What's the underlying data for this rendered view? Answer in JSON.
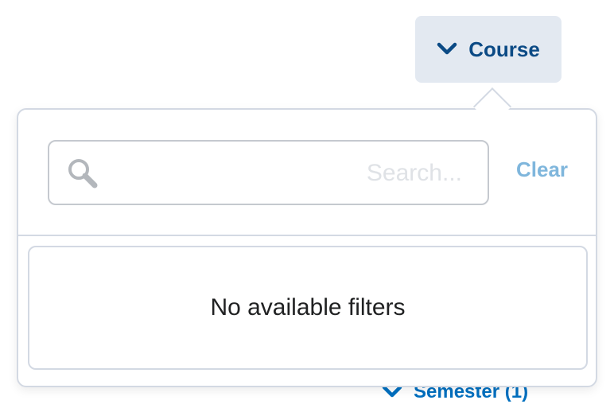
{
  "course_filter": {
    "label": "Course",
    "icon": "chevron-down-icon",
    "expanded": true
  },
  "search": {
    "placeholder": "...Search",
    "value": "",
    "icon": "search-icon"
  },
  "clear_label": "Clear",
  "empty_message": "No available filters",
  "semester_filter": {
    "label": "Semester (1)",
    "icon": "chevron-down-icon"
  },
  "colors": {
    "accent": "#006fbf",
    "opener_bg": "#e3e9f1",
    "opener_text": "#0b4a85",
    "clear_text": "#7fb6dc",
    "border": "#d3d9e3"
  }
}
